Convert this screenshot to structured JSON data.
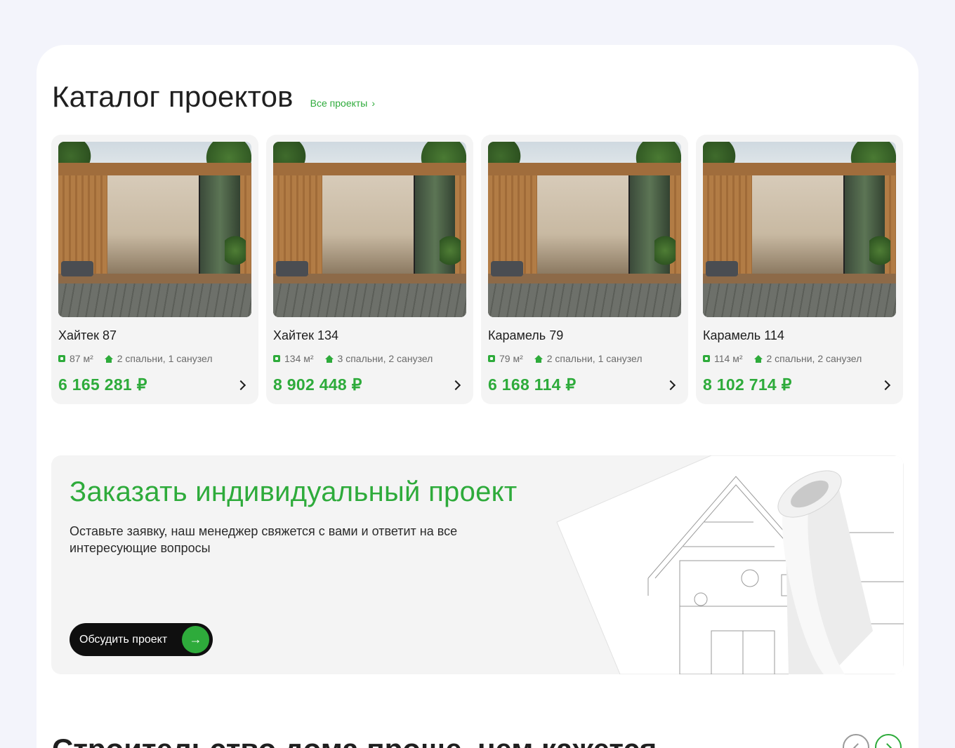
{
  "catalog": {
    "title": "Каталог проектов",
    "all_link": "Все проекты",
    "all_link_chevron": "›",
    "cards": [
      {
        "name": "Хайтек 87",
        "area": "87 м²",
        "rooms": "2 спальни, 1 санузел",
        "price": "6 165 281 ₽"
      },
      {
        "name": "Хайтек 134",
        "area": "134 м²",
        "rooms": "3 спальни, 2 санузел",
        "price": "8 902 448 ₽"
      },
      {
        "name": "Карамель 79",
        "area": "79 м²",
        "rooms": "2 спальни, 1 санузел",
        "price": "6 168 114 ₽"
      },
      {
        "name": "Карамель 114",
        "area": "114 м²",
        "rooms": "2 спальни, 2 санузел",
        "price": "8 102 714 ₽"
      }
    ]
  },
  "order": {
    "title": "Заказать индивидуальный проект",
    "subtitle": "Оставьте заявку, наш менеджер свяжется с вами и ответит на все интересующие вопросы",
    "button_label": "Обсудить проект",
    "button_arrow": "→"
  },
  "next_section": {
    "title": "Строительство дома проще, чем кажется"
  },
  "colors": {
    "accent": "#2eab3b",
    "page_bg": "#f3f4fb",
    "card_bg": "#f4f4f4",
    "button_bg": "#0f0f0f"
  },
  "icons": {
    "area": "area-square-icon",
    "rooms": "house-icon",
    "card_arrow": "chevron-right-icon",
    "carousel_prev": "chevron-left-icon",
    "carousel_next": "chevron-right-icon"
  }
}
